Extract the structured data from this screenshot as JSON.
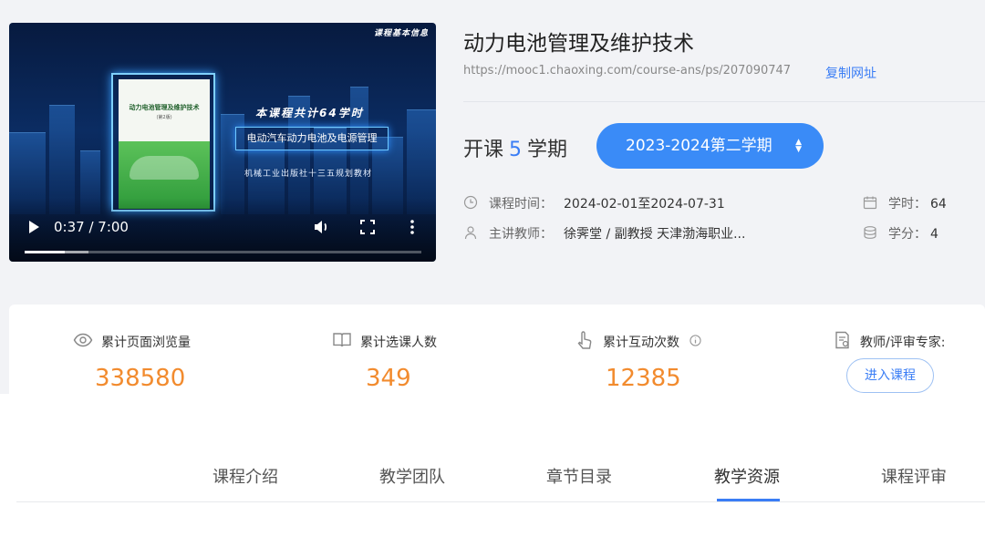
{
  "video": {
    "banner": "课程基本信息",
    "book_title": "动力电池管理及维护技术",
    "book_edition": "(第2版)",
    "heading": "本课程共计64学时",
    "subtitle": "电动汽车动力电池及电源管理",
    "publisher": "机械工业出版社十三五规划教材",
    "time": "0:37 / 7:00",
    "progress_played": 0.1,
    "progress_buffered": 0.16
  },
  "course": {
    "title": "动力电池管理及维护技术",
    "url": "https://mooc1.chaoxing.com/course-ans/ps/207090747",
    "copy_label": "复制网址",
    "sessions_prefix": "开课",
    "sessions_count": "5",
    "sessions_suffix": "学期",
    "semester": "2023-2024第二学期",
    "time_label": "课程时间：",
    "time_value": "2024-02-01至2024-07-31",
    "teacher_label": "主讲教师：",
    "teacher_value": "徐霁堂 / 副教授 天津渤海职业...",
    "hours_label": "学时：",
    "hours_value": "64",
    "credits_label": "学分：",
    "credits_value": "4"
  },
  "stats": {
    "views_label": "累计页面浏览量",
    "views_value": "338580",
    "enrolled_label": "累计选课人数",
    "enrolled_value": "349",
    "interactions_label": "累计互动次数",
    "interactions_value": "12385",
    "expert_label": "教师/评审专家:",
    "enter_label": "进入课程"
  },
  "tabs": [
    {
      "label": "课程介绍"
    },
    {
      "label": "教学团队"
    },
    {
      "label": "章节目录"
    },
    {
      "label": "教学资源"
    },
    {
      "label": "课程评审"
    }
  ],
  "active_tab": "教学资源",
  "colors": {
    "accent": "#3a7df5",
    "stat_number": "#f28b2e",
    "semester_button": "#3a8bf7"
  }
}
